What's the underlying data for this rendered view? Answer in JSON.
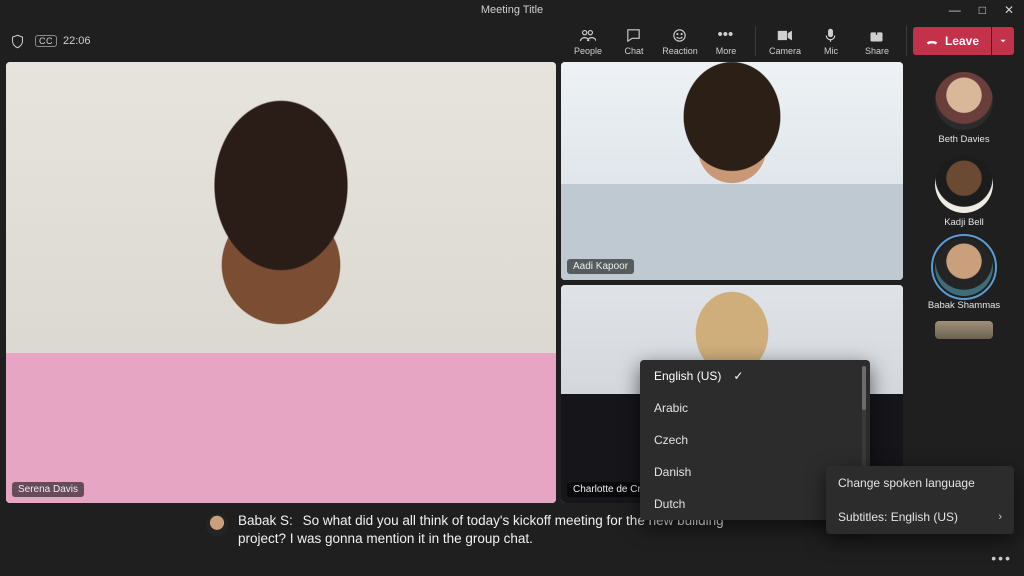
{
  "window": {
    "title": "Meeting Title",
    "minimize": "—",
    "maximize": "□",
    "close": "✕"
  },
  "toolbar": {
    "timer": "22:06",
    "cc": "CC",
    "people": "People",
    "chat": "Chat",
    "reaction": "Reaction",
    "more": "More",
    "camera": "Camera",
    "mic": "Mic",
    "share": "Share",
    "leave": "Leave"
  },
  "participants": {
    "main": {
      "name": "Serena Davis"
    },
    "top_right": {
      "name": "Aadi Kapoor"
    },
    "bottom_right": {
      "name": "Charlotte de Crum"
    }
  },
  "sidebar": [
    {
      "name": "Beth Davies",
      "active": false
    },
    {
      "name": "Kadji Bell",
      "active": false
    },
    {
      "name": "Babak Shammas",
      "active": true
    }
  ],
  "caption": {
    "speaker": "Babak S:",
    "text": "So what did you all think of today's kickoff meeting for the new building project? I was gonna mention it in the group chat."
  },
  "language_menu": {
    "selected": "English (US)",
    "options": [
      "Arabic",
      "Czech",
      "Danish",
      "Dutch"
    ]
  },
  "settings_menu": {
    "change_lang": "Change spoken language",
    "subtitles": "Subtitles: English (US)"
  }
}
